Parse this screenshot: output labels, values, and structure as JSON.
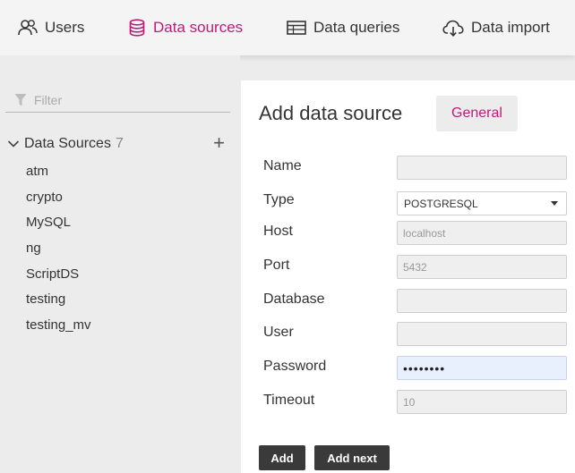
{
  "nav": {
    "items": [
      {
        "label": "Users",
        "icon": "users-icon"
      },
      {
        "label": "Data sources",
        "icon": "database-icon",
        "active": true
      },
      {
        "label": "Data queries",
        "icon": "table-icon"
      },
      {
        "label": "Data import",
        "icon": "cloud-download-icon"
      }
    ]
  },
  "sidebar": {
    "filter_placeholder": "Filter",
    "tree_title": "Data Sources",
    "tree_count": "7",
    "items": [
      "atm",
      "crypto",
      "MySQL",
      "ng",
      "ScriptDS",
      "testing",
      "testing_mv"
    ]
  },
  "form": {
    "title": "Add data source",
    "tab_general": "General",
    "labels": {
      "name": "Name",
      "type": "Type",
      "host": "Host",
      "port": "Port",
      "database": "Database",
      "user": "User",
      "password": "Password",
      "timeout": "Timeout"
    },
    "values": {
      "name": "",
      "type": "POSTGRESQL",
      "host_placeholder": "localhost",
      "port_placeholder": "5432",
      "database": "",
      "user": "",
      "password": "••••••••",
      "timeout_placeholder": "10"
    },
    "buttons": {
      "add": "Add",
      "add_next": "Add next"
    }
  },
  "colors": {
    "accent": "#c2197a",
    "button_bg": "#3a3a3a",
    "page_bg": "#ececec"
  }
}
